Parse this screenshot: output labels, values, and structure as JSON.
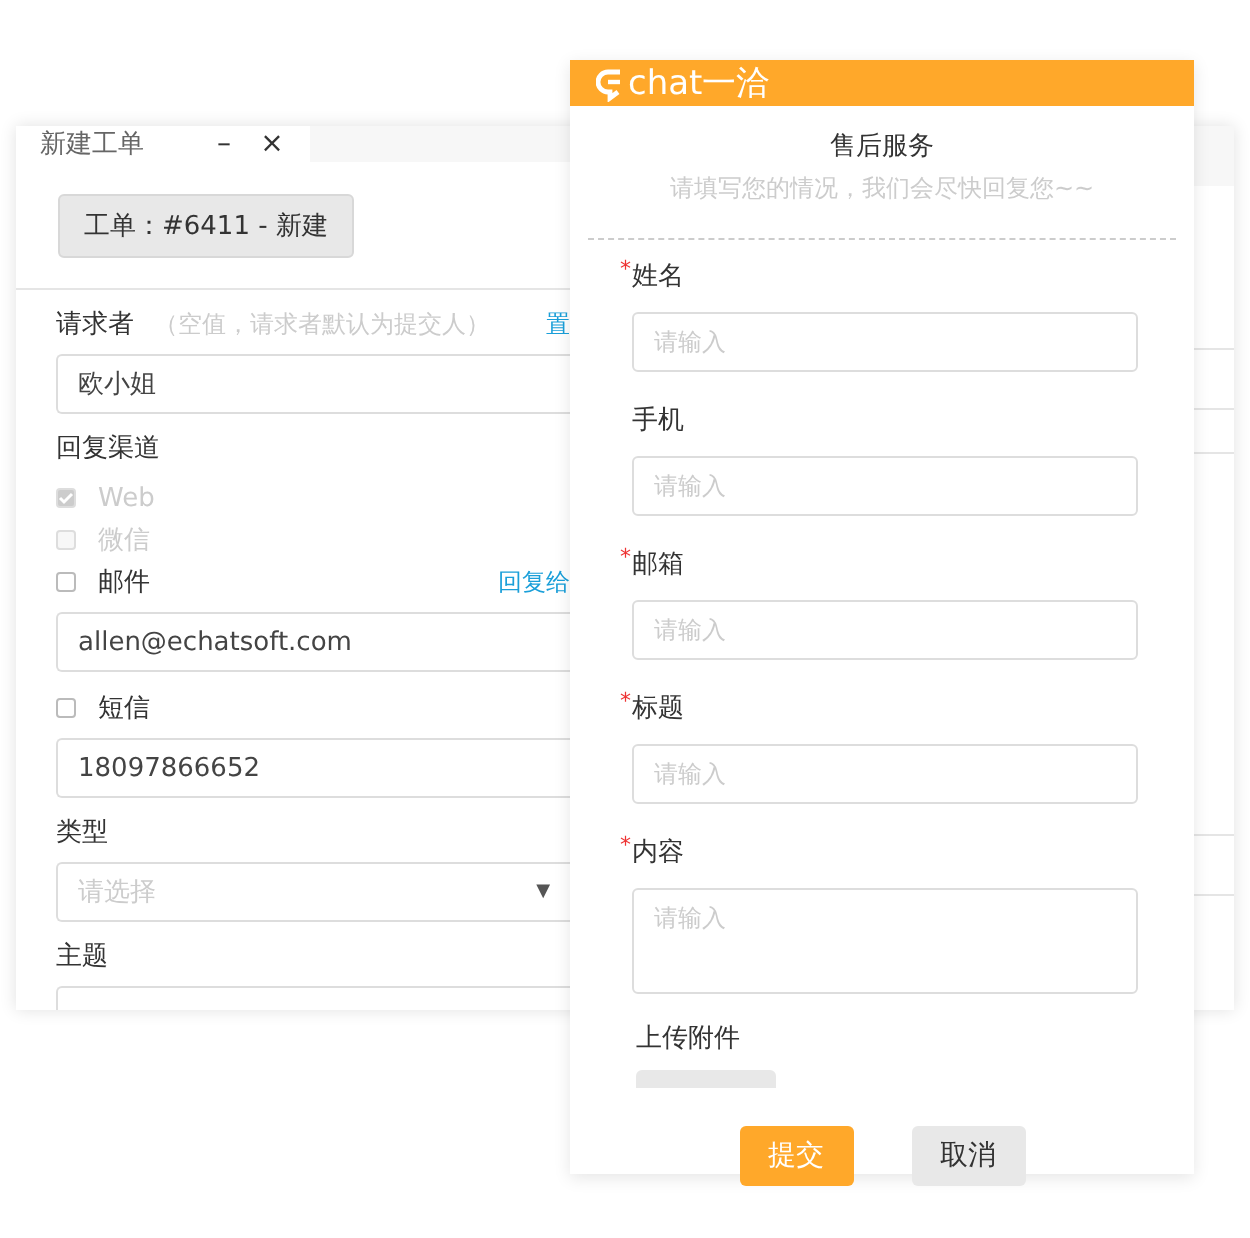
{
  "ticket_window": {
    "tab": {
      "title": "新建工单",
      "minimize": "–",
      "close": "×"
    },
    "ticket_badge": "工单：#6411 - 新建",
    "requester": {
      "label": "请求者",
      "hint": "（空值，请求者默认为提交人）",
      "action": "置",
      "value": "欧小姐"
    },
    "reply_channel": {
      "label": "回复渠道",
      "channels": [
        {
          "label": "Web",
          "checked": true,
          "disabled": true
        },
        {
          "label": "微信",
          "checked": false,
          "disabled": true
        },
        {
          "label": "邮件",
          "checked": false,
          "disabled": false,
          "link": "回复给",
          "value": "allen@echatsoft.com"
        },
        {
          "label": "短信",
          "checked": false,
          "disabled": false,
          "value": "18097866652"
        }
      ]
    },
    "type": {
      "label": "类型",
      "placeholder": "请选择",
      "caret": "▼"
    },
    "subject": {
      "label": "主题"
    }
  },
  "service_form": {
    "logo": "chat一洽",
    "title": "售后服务",
    "subtitle": "请填写您的情况，我们会尽快回复您~~",
    "fields": [
      {
        "label": "姓名",
        "required": true,
        "kind": "input",
        "placeholder": "请输入"
      },
      {
        "label": "手机",
        "required": false,
        "kind": "input",
        "placeholder": "请输入"
      },
      {
        "label": "邮箱",
        "required": true,
        "kind": "input",
        "placeholder": "请输入"
      },
      {
        "label": "标题",
        "required": true,
        "kind": "input",
        "placeholder": "请输入"
      },
      {
        "label": "内容",
        "required": true,
        "kind": "textarea",
        "placeholder": "请输入"
      }
    ],
    "required_mark": "*",
    "attachment_label": "上传附件",
    "buttons": [
      {
        "label": "提交",
        "kind": "primary"
      },
      {
        "label": "取消",
        "kind": "secondary"
      }
    ]
  }
}
